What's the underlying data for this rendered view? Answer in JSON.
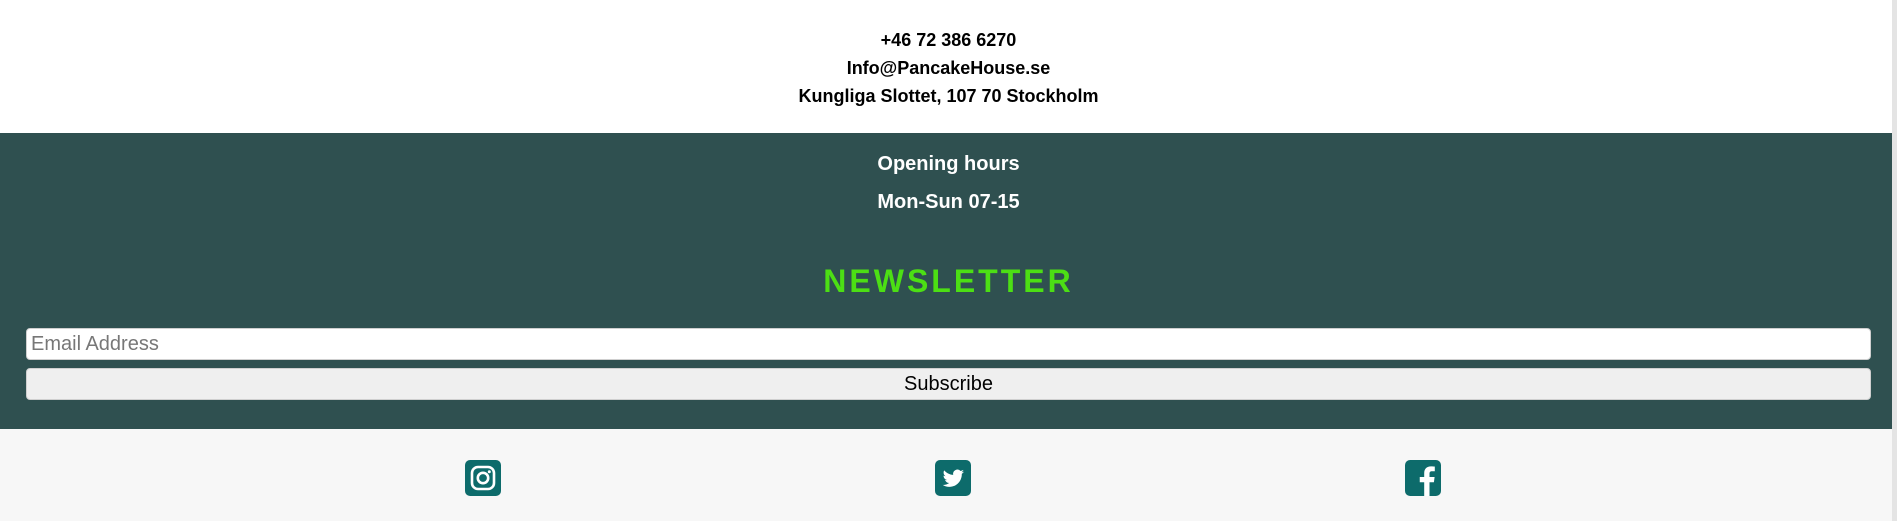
{
  "contact": {
    "phone": "+46 72 386 6270",
    "email": "Info@PancakeHouse.se",
    "address": "Kungliga Slottet, 107 70 Stockholm"
  },
  "hours": {
    "title": "Opening hours",
    "value": "Mon-Sun 07-15"
  },
  "newsletter": {
    "title": "NEWSLETTER",
    "email_placeholder": "Email Address",
    "email_value": "",
    "subscribe_label": "Subscribe",
    "title_color": "#4cdf14"
  },
  "social": {
    "icons": [
      "instagram-icon",
      "twitter-icon",
      "facebook-icon"
    ],
    "icon_color": "#0d6b6b"
  },
  "colors": {
    "dark_band": "#2f5050",
    "social_band": "#f7f7f7"
  }
}
